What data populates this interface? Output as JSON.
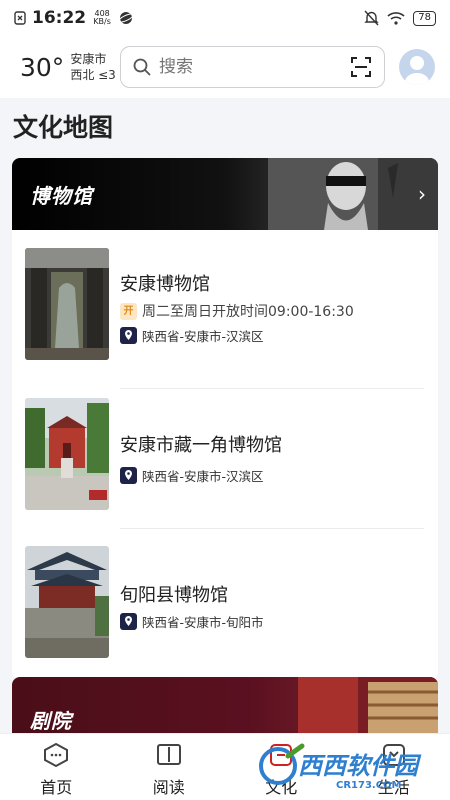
{
  "status_bar": {
    "time": "16:22",
    "net_speed_value": "408",
    "net_speed_unit": "KB/s",
    "battery": "78"
  },
  "header": {
    "temperature": "30°",
    "city": "安康市",
    "wind": "西北 ≤3",
    "search_placeholder": "搜索"
  },
  "page_title": "文化地图",
  "museum_section": {
    "title": "博物馆",
    "items": [
      {
        "name": "安康博物馆",
        "hours_badge": "开",
        "hours": "周二至周日开放时间09:00-16:30",
        "address": "陕西省-安康市-汉滨区"
      },
      {
        "name": "安康市藏一角博物馆",
        "address": "陕西省-安康市-汉滨区"
      },
      {
        "name": "旬阳县博物馆",
        "address": "陕西省-安康市-旬阳市"
      }
    ]
  },
  "theatre_section": {
    "title": "剧院"
  },
  "bottom_nav": {
    "items": [
      {
        "label": "首页",
        "icon": "home-icon"
      },
      {
        "label": "阅读",
        "icon": "book-icon"
      },
      {
        "label": "文化",
        "icon": "culture-icon"
      },
      {
        "label": "生活",
        "icon": "life-icon"
      }
    ]
  },
  "watermark": {
    "text": "西西软件园",
    "sub": "CR173.COM"
  },
  "colors": {
    "accent": "#1d2447",
    "hours_badge": "#e08a1a",
    "theatre_banner": "#5a1020"
  }
}
